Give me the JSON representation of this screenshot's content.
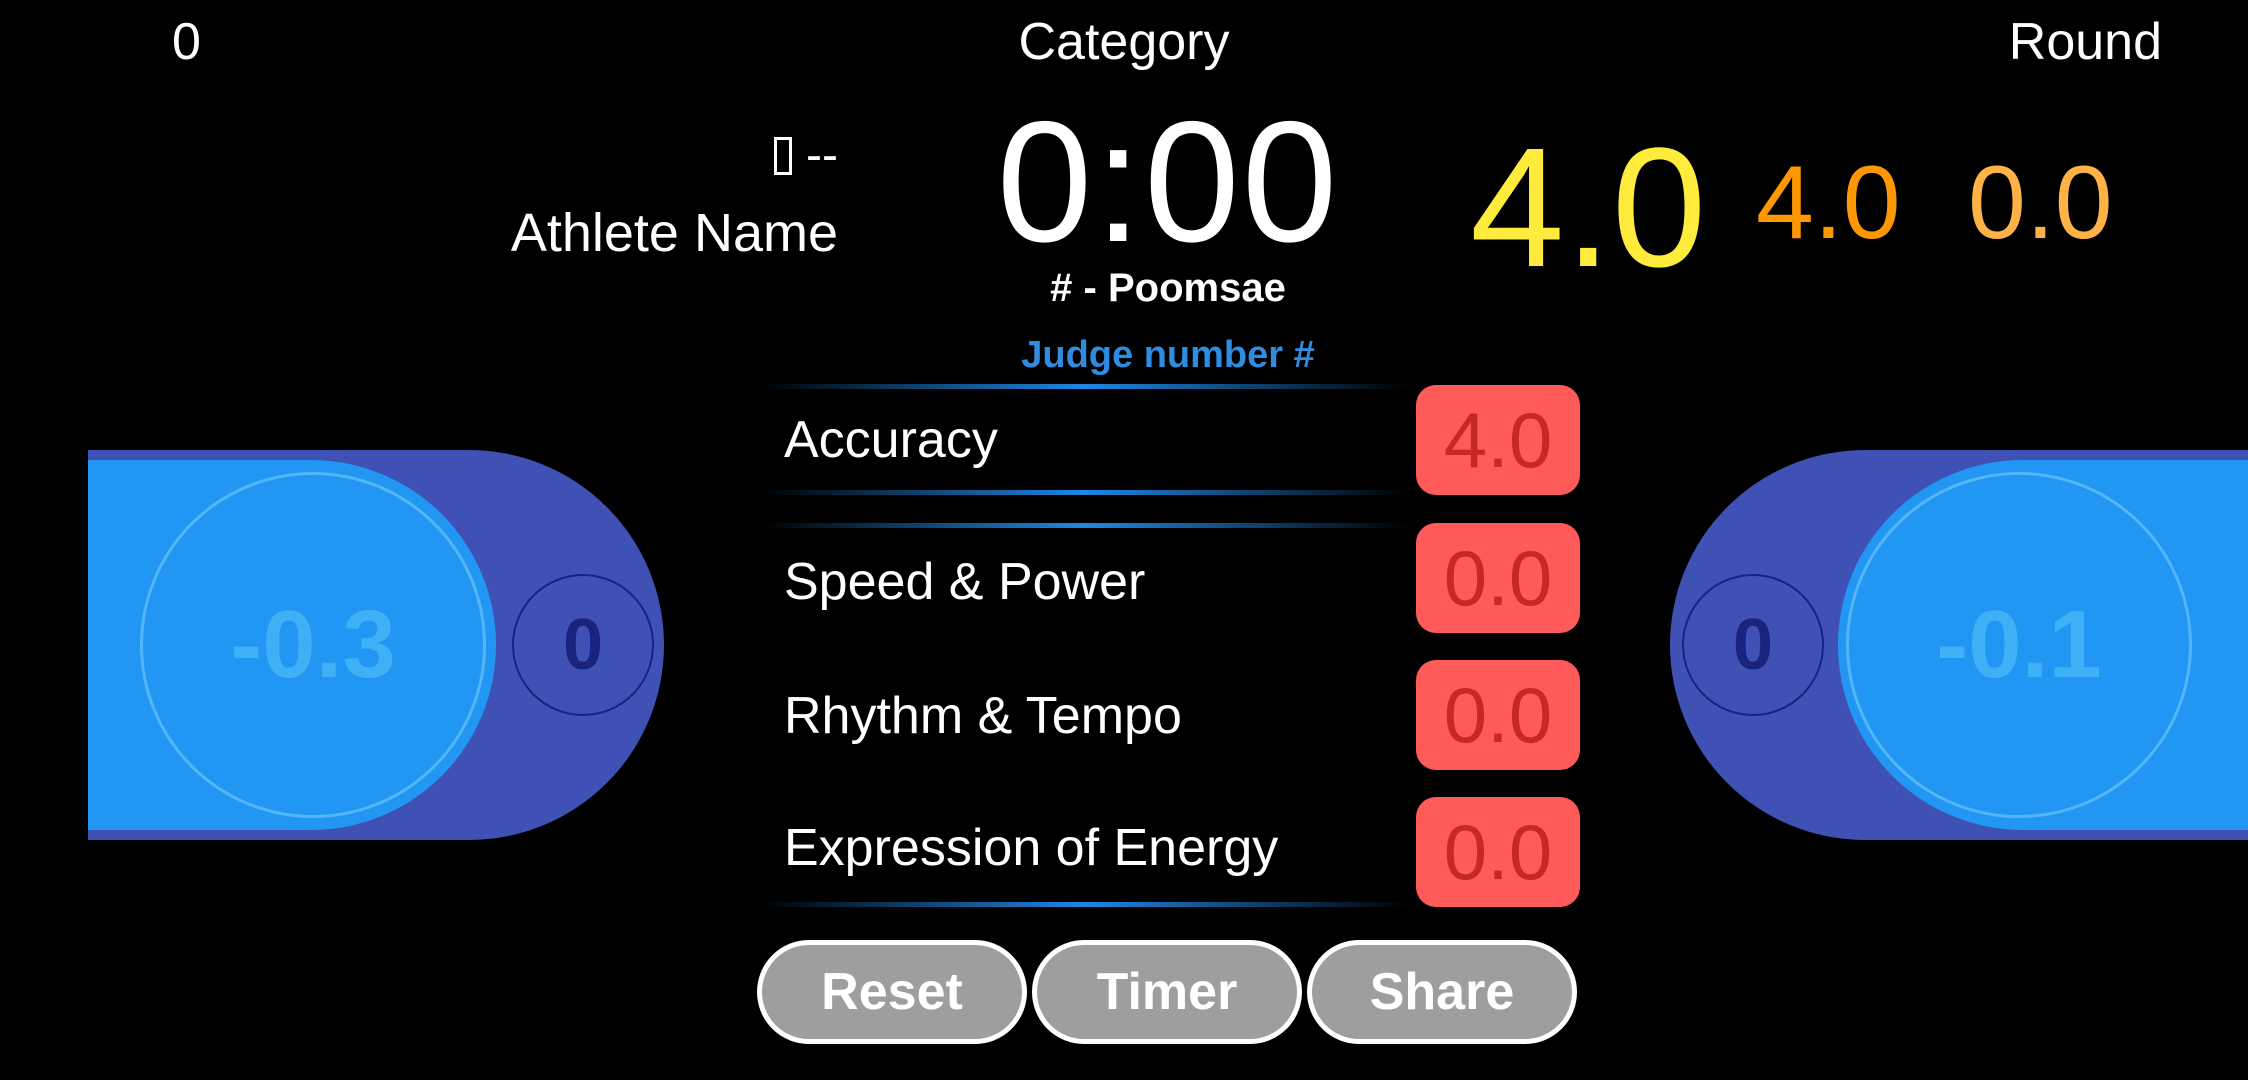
{
  "top": {
    "left_value": "0",
    "category": "Category",
    "round": "Round"
  },
  "athlete": {
    "flag_text": "--",
    "name": "Athlete Name"
  },
  "timer": "0:00",
  "poomsae": "# - Poomsae",
  "judge": "Judge number #",
  "scores": {
    "total": "4.0",
    "accuracy": "4.0",
    "presentation": "0.0"
  },
  "criteria": [
    {
      "label": "Accuracy",
      "value": "4.0"
    },
    {
      "label": "Speed & Power",
      "value": "0.0"
    },
    {
      "label": "Rhythm & Tempo",
      "value": "0.0"
    },
    {
      "label": "Expression of Energy",
      "value": "0.0"
    }
  ],
  "left_deduction": {
    "value": "-0.3",
    "count": "0"
  },
  "right_deduction": {
    "value": "-0.1",
    "count": "0"
  },
  "buttons": {
    "reset": "Reset",
    "timer": "Timer",
    "share": "Share"
  },
  "colors": {
    "total": "#ffeb3b",
    "accuracy": "#ff9800",
    "presentation": "#ffb347",
    "judge": "#2e8de0",
    "criteria_box": "#ff5a5a",
    "panel_dark": "#3f51b5",
    "panel_light": "#2196f3"
  }
}
